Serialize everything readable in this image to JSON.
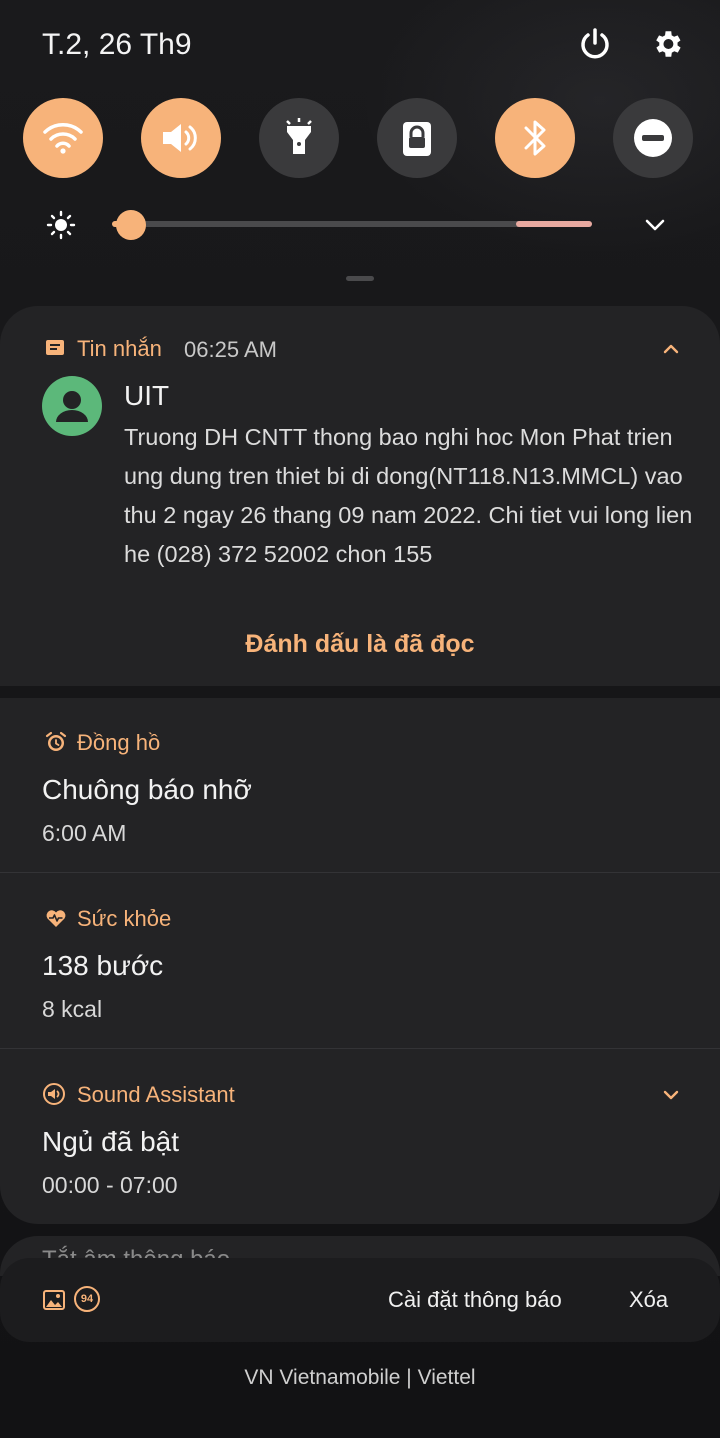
{
  "status": {
    "date": "T.2, 26 Th9"
  },
  "colors": {
    "accent": "#f7b37a",
    "card": "#232325",
    "background": "#141416",
    "avatar": "#5cb87a"
  },
  "quick_toggles": [
    {
      "name": "wifi",
      "on": true
    },
    {
      "name": "sound",
      "on": true
    },
    {
      "name": "flashlight",
      "on": false
    },
    {
      "name": "screen-lock",
      "on": false
    },
    {
      "name": "bluetooth",
      "on": true
    },
    {
      "name": "do-not-disturb",
      "on": false
    }
  ],
  "brightness": {
    "level": 0.04
  },
  "notifications": {
    "messages": {
      "app": "Tin nhắn",
      "time": "06:25 AM",
      "sender": "UIT",
      "body": "Truong DH CNTT thong bao nghi hoc Mon Phat trien ung dung tren thiet bi di dong(NT118.N13.MMCL) vao thu 2 ngay 26 thang 09 nam 2022. Chi tiet vui long lien he (028) 372 52002 chon 155",
      "action": "Đánh dấu là đã đọc"
    },
    "clock": {
      "app": "Đồng hồ",
      "title": "Chuông báo nhỡ",
      "sub": "6:00 AM"
    },
    "health": {
      "app": "Sức khỏe",
      "title": "138 bước",
      "sub": "8 kcal"
    },
    "sound_assistant": {
      "app": "Sound Assistant",
      "title": "Ngủ đã bật",
      "sub": "00:00 - 07:00"
    },
    "peek": {
      "text": "Tắt âm thông báo"
    }
  },
  "bottom_bar": {
    "badge": "94",
    "settings_label": "Cài đặt thông báo",
    "clear_label": "Xóa"
  },
  "carrier": "VN Vietnamobile | Viettel"
}
